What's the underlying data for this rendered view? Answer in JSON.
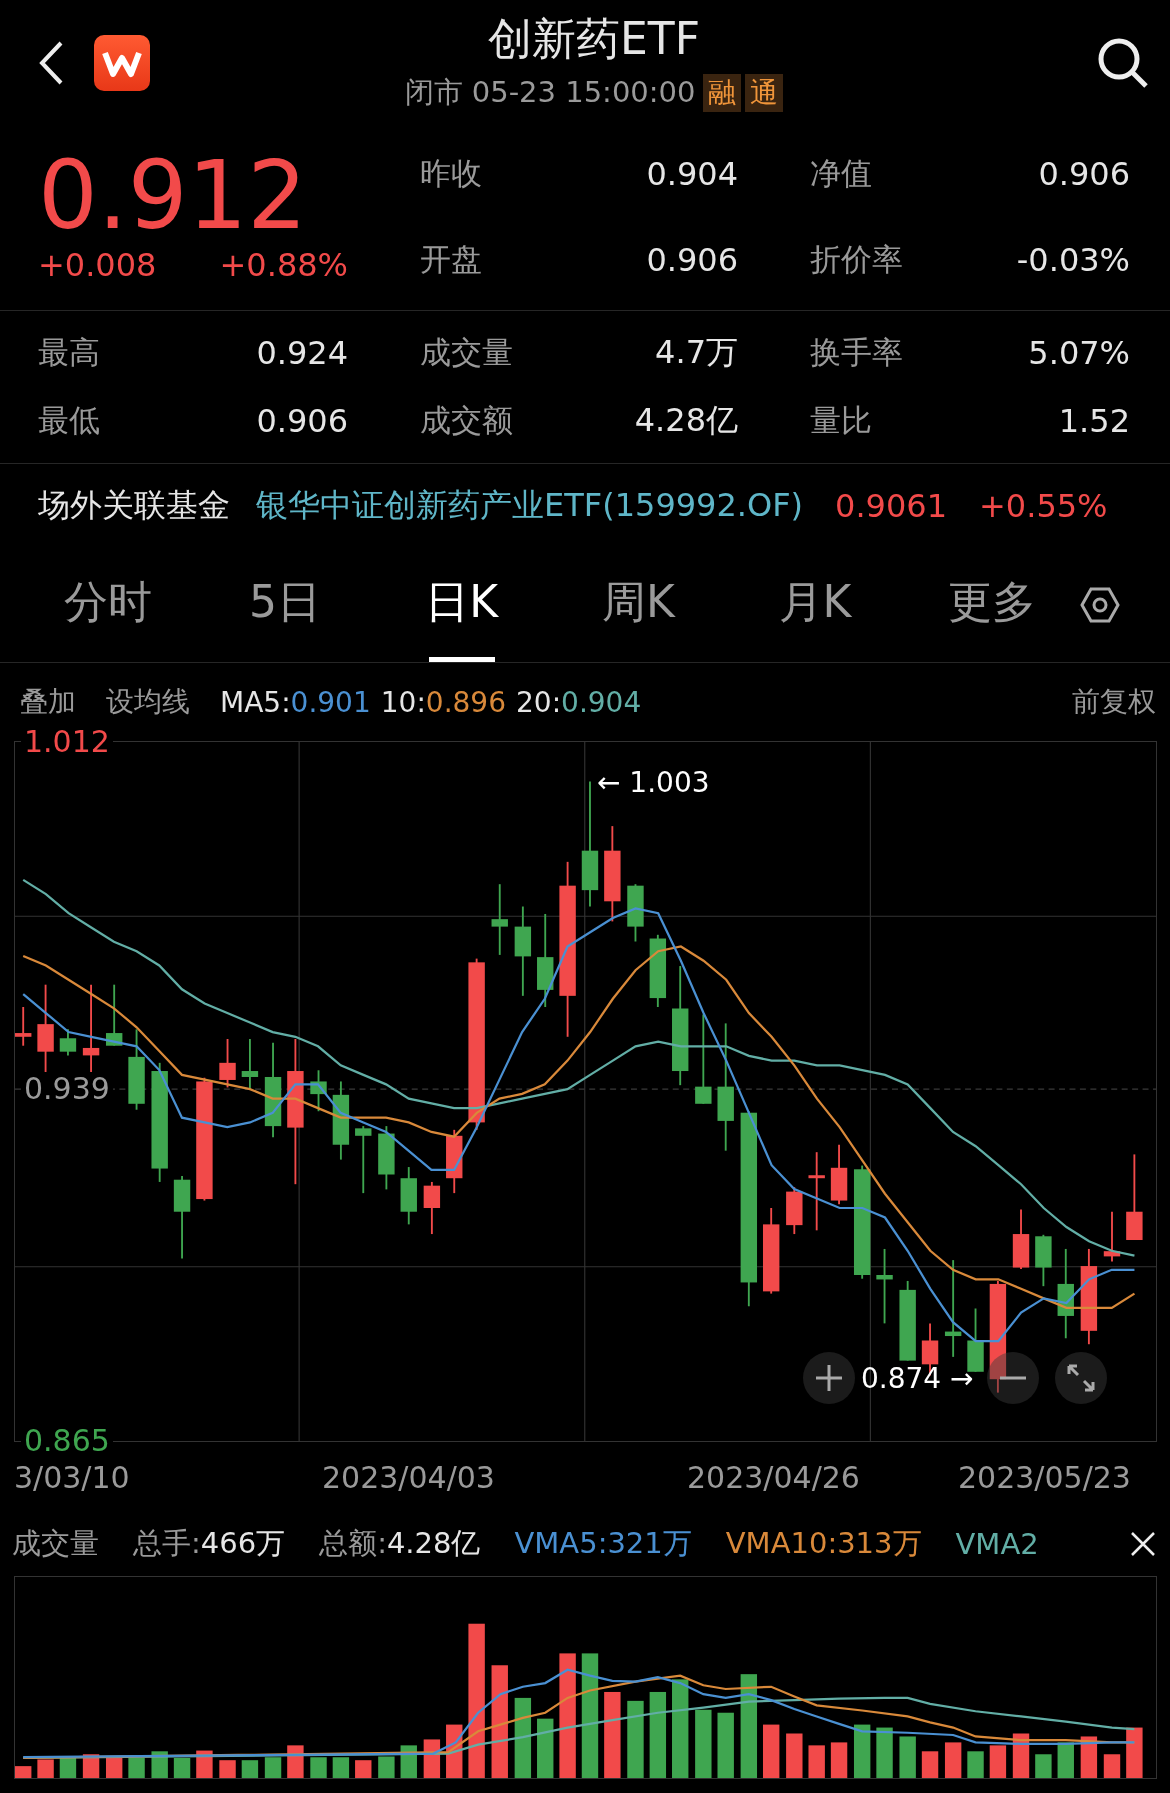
{
  "header": {
    "title": "创新药ETF",
    "status": "闭市 05-23 15:00:00",
    "tags": [
      "融",
      "通"
    ]
  },
  "quote": {
    "price": "0.912",
    "change": "+0.008",
    "change_pct": "+0.88%",
    "rising": true
  },
  "stats_top": [
    {
      "label": "昨收",
      "value": "0.904"
    },
    {
      "label": "净值",
      "value": "0.906"
    },
    {
      "label": "开盘",
      "value": "0.906"
    },
    {
      "label": "折价率",
      "value": "-0.03%"
    }
  ],
  "stats": [
    {
      "label": "最高",
      "value": "0.924"
    },
    {
      "label": "成交量",
      "value": "4.7万"
    },
    {
      "label": "换手率",
      "value": "5.07%"
    },
    {
      "label": "最低",
      "value": "0.906"
    },
    {
      "label": "成交额",
      "value": "4.28亿"
    },
    {
      "label": "量比",
      "value": "1.52"
    }
  ],
  "linked_fund": {
    "label": "场外关联基金",
    "name": "银华中证创新药产业ETF(159992.OF)",
    "price": "0.9061",
    "change_pct": "+0.55%"
  },
  "tabs": [
    {
      "label": "分时",
      "selected": false
    },
    {
      "label": "5日",
      "selected": false
    },
    {
      "label": "日K",
      "selected": true
    },
    {
      "label": "周K",
      "selected": false
    },
    {
      "label": "月K",
      "selected": false
    },
    {
      "label": "更多",
      "selected": false
    }
  ],
  "ma_bar": {
    "buttons": [
      "叠加",
      "设均线"
    ],
    "separator": ":",
    "values": [
      "0.901",
      "0.896",
      "0.904"
    ],
    "adjust": "前复权"
  },
  "kline": {
    "max_marker": "← 1.003",
    "min_marker": "0.874 →",
    "x_labels": [
      "3/03/10",
      "2023/04/03",
      "2023/04/26",
      "2023/05/23"
    ],
    "chart_data": {
      "type": "line",
      "ylim": [
        0.865,
        1.012
      ],
      "yticks": [
        1.012,
        0.939,
        0.865
      ],
      "series": [
        {
          "name": "MA5",
          "color": "#4a90d2",
          "values": [
            0.959,
            0.955,
            0.951,
            0.95,
            0.949,
            0.948,
            0.943,
            0.933,
            0.932,
            0.931,
            0.932,
            0.934,
            0.94,
            0.94,
            0.934,
            0.932,
            0.93,
            0.926,
            0.922,
            0.922,
            0.931,
            0.941,
            0.951,
            0.958,
            0.969,
            0.972,
            0.975,
            0.977,
            0.976,
            0.966,
            0.955,
            0.945,
            0.934,
            0.923,
            0.918,
            0.916,
            0.914,
            0.914,
            0.912,
            0.905,
            0.897,
            0.89,
            0.886,
            0.886,
            0.892,
            0.895,
            0.894,
            0.899,
            0.901,
            0.901
          ]
        },
        {
          "name": "10",
          "color": "#d9893a",
          "values": [
            0.967,
            0.965,
            0.962,
            0.959,
            0.956,
            0.952,
            0.947,
            0.942,
            0.941,
            0.94,
            0.939,
            0.937,
            0.937,
            0.935,
            0.933,
            0.933,
            0.933,
            0.932,
            0.93,
            0.929,
            0.934,
            0.937,
            0.938,
            0.94,
            0.945,
            0.951,
            0.958,
            0.964,
            0.968,
            0.969,
            0.966,
            0.962,
            0.955,
            0.95,
            0.944,
            0.937,
            0.931,
            0.924,
            0.917,
            0.911,
            0.905,
            0.901,
            0.899,
            0.899,
            0.897,
            0.895,
            0.893,
            0.893,
            0.893,
            0.896
          ]
        },
        {
          "name": "20",
          "color": "#62aea6",
          "values": [
            0.983,
            0.98,
            0.976,
            0.973,
            0.97,
            0.968,
            0.965,
            0.96,
            0.957,
            0.955,
            0.953,
            0.951,
            0.95,
            0.948,
            0.944,
            0.942,
            0.94,
            0.937,
            0.936,
            0.935,
            0.935,
            0.936,
            0.937,
            0.938,
            0.939,
            0.942,
            0.945,
            0.948,
            0.949,
            0.948,
            0.948,
            0.948,
            0.946,
            0.945,
            0.945,
            0.944,
            0.944,
            0.943,
            0.942,
            0.94,
            0.935,
            0.93,
            0.927,
            0.923,
            0.919,
            0.914,
            0.91,
            0.907,
            0.905,
            0.904
          ]
        }
      ]
    }
  },
  "volume": {
    "title": "成交量",
    "stats": [
      {
        "label": "总手:",
        "value": "466万"
      },
      {
        "label": "总额:",
        "value": "4.28亿"
      }
    ],
    "indicators": [
      {
        "text": "VMA5:321万",
        "color": "#4a90d2"
      },
      {
        "text": "VMA10:313万",
        "color": "#d9893a"
      },
      {
        "text": "VMA2",
        "color": "#62aea6"
      }
    ]
  }
}
